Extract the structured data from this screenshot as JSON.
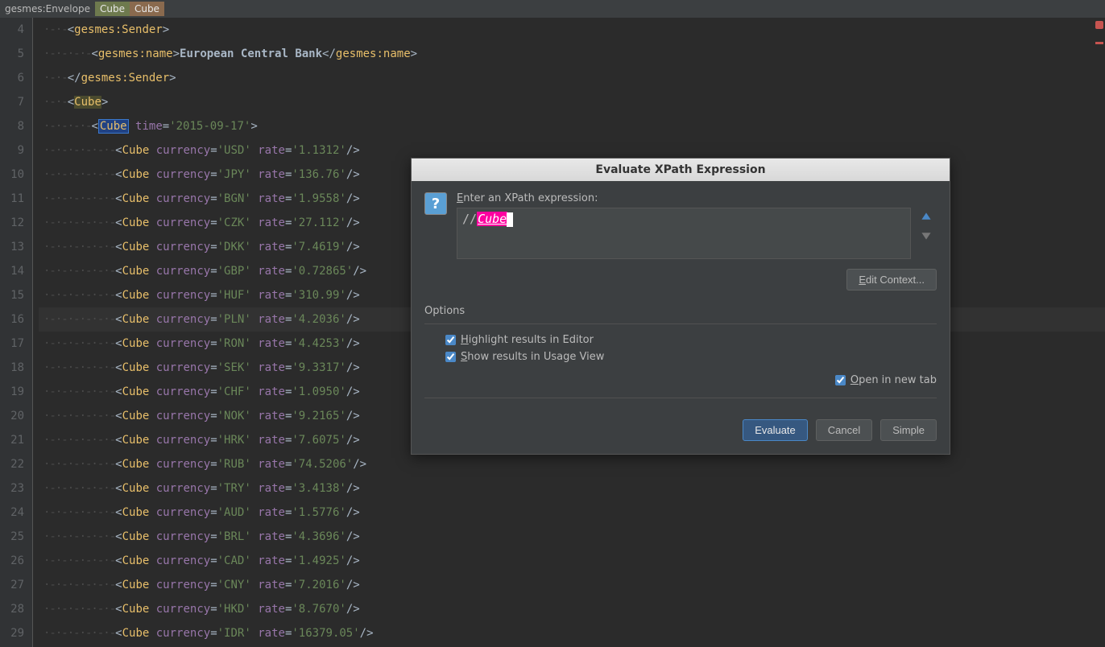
{
  "breadcrumb": {
    "root": "gesmes:Envelope",
    "item1": "Cube",
    "item2": "Cube"
  },
  "gutter": {
    "start": 4,
    "end": 29
  },
  "code": {
    "lines": [
      {
        "n": 4,
        "type": "open",
        "indent": 1,
        "tag": "gesmes:Sender"
      },
      {
        "n": 5,
        "type": "text",
        "indent": 2,
        "tag": "gesmes:name",
        "content": "European Central Bank"
      },
      {
        "n": 6,
        "type": "close",
        "indent": 1,
        "tag": "gesmes:Sender"
      },
      {
        "n": 7,
        "type": "open",
        "indent": 1,
        "tag": "Cube",
        "hl": "dark"
      },
      {
        "n": 8,
        "type": "self",
        "indent": 2,
        "tag": "Cube",
        "attrs": [
          [
            "time",
            "2015-09-17"
          ]
        ],
        "noclose": true,
        "hl": "sel"
      },
      {
        "n": 9,
        "type": "self",
        "indent": 3,
        "tag": "Cube",
        "attrs": [
          [
            "currency",
            "USD"
          ],
          [
            "rate",
            "1.1312"
          ]
        ]
      },
      {
        "n": 10,
        "type": "self",
        "indent": 3,
        "tag": "Cube",
        "attrs": [
          [
            "currency",
            "JPY"
          ],
          [
            "rate",
            "136.76"
          ]
        ]
      },
      {
        "n": 11,
        "type": "self",
        "indent": 3,
        "tag": "Cube",
        "attrs": [
          [
            "currency",
            "BGN"
          ],
          [
            "rate",
            "1.9558"
          ]
        ]
      },
      {
        "n": 12,
        "type": "self",
        "indent": 3,
        "tag": "Cube",
        "attrs": [
          [
            "currency",
            "CZK"
          ],
          [
            "rate",
            "27.112"
          ]
        ]
      },
      {
        "n": 13,
        "type": "self",
        "indent": 3,
        "tag": "Cube",
        "attrs": [
          [
            "currency",
            "DKK"
          ],
          [
            "rate",
            "7.4619"
          ]
        ]
      },
      {
        "n": 14,
        "type": "self",
        "indent": 3,
        "tag": "Cube",
        "attrs": [
          [
            "currency",
            "GBP"
          ],
          [
            "rate",
            "0.72865"
          ]
        ]
      },
      {
        "n": 15,
        "type": "self",
        "indent": 3,
        "tag": "Cube",
        "attrs": [
          [
            "currency",
            "HUF"
          ],
          [
            "rate",
            "310.99"
          ]
        ]
      },
      {
        "n": 16,
        "type": "self",
        "indent": 3,
        "tag": "Cube",
        "attrs": [
          [
            "currency",
            "PLN"
          ],
          [
            "rate",
            "4.2036"
          ]
        ],
        "current": true
      },
      {
        "n": 17,
        "type": "self",
        "indent": 3,
        "tag": "Cube",
        "attrs": [
          [
            "currency",
            "RON"
          ],
          [
            "rate",
            "4.4253"
          ]
        ]
      },
      {
        "n": 18,
        "type": "self",
        "indent": 3,
        "tag": "Cube",
        "attrs": [
          [
            "currency",
            "SEK"
          ],
          [
            "rate",
            "9.3317"
          ]
        ]
      },
      {
        "n": 19,
        "type": "self",
        "indent": 3,
        "tag": "Cube",
        "attrs": [
          [
            "currency",
            "CHF"
          ],
          [
            "rate",
            "1.0950"
          ]
        ]
      },
      {
        "n": 20,
        "type": "self",
        "indent": 3,
        "tag": "Cube",
        "attrs": [
          [
            "currency",
            "NOK"
          ],
          [
            "rate",
            "9.2165"
          ]
        ]
      },
      {
        "n": 21,
        "type": "self",
        "indent": 3,
        "tag": "Cube",
        "attrs": [
          [
            "currency",
            "HRK"
          ],
          [
            "rate",
            "7.6075"
          ]
        ]
      },
      {
        "n": 22,
        "type": "self",
        "indent": 3,
        "tag": "Cube",
        "attrs": [
          [
            "currency",
            "RUB"
          ],
          [
            "rate",
            "74.5206"
          ]
        ]
      },
      {
        "n": 23,
        "type": "self",
        "indent": 3,
        "tag": "Cube",
        "attrs": [
          [
            "currency",
            "TRY"
          ],
          [
            "rate",
            "3.4138"
          ]
        ]
      },
      {
        "n": 24,
        "type": "self",
        "indent": 3,
        "tag": "Cube",
        "attrs": [
          [
            "currency",
            "AUD"
          ],
          [
            "rate",
            "1.5776"
          ]
        ]
      },
      {
        "n": 25,
        "type": "self",
        "indent": 3,
        "tag": "Cube",
        "attrs": [
          [
            "currency",
            "BRL"
          ],
          [
            "rate",
            "4.3696"
          ]
        ]
      },
      {
        "n": 26,
        "type": "self",
        "indent": 3,
        "tag": "Cube",
        "attrs": [
          [
            "currency",
            "CAD"
          ],
          [
            "rate",
            "1.4925"
          ]
        ]
      },
      {
        "n": 27,
        "type": "self",
        "indent": 3,
        "tag": "Cube",
        "attrs": [
          [
            "currency",
            "CNY"
          ],
          [
            "rate",
            "7.2016"
          ]
        ]
      },
      {
        "n": 28,
        "type": "self",
        "indent": 3,
        "tag": "Cube",
        "attrs": [
          [
            "currency",
            "HKD"
          ],
          [
            "rate",
            "8.7670"
          ]
        ]
      },
      {
        "n": 29,
        "type": "self",
        "indent": 3,
        "tag": "Cube",
        "attrs": [
          [
            "currency",
            "IDR"
          ],
          [
            "rate",
            "16379.05"
          ]
        ]
      }
    ]
  },
  "dialog": {
    "title": "Evaluate XPath Expression",
    "enter_label": "Enter an XPath expression:",
    "xpath_prefix": "//",
    "xpath_token": "Cube",
    "edit_context": "Edit Context...",
    "options_label": "Options",
    "highlight_label": "Highlight results in Editor",
    "show_label": "Show results in Usage View",
    "open_tab_label": "Open in new tab",
    "evaluate": "Evaluate",
    "cancel": "Cancel",
    "simple": "Simple"
  }
}
